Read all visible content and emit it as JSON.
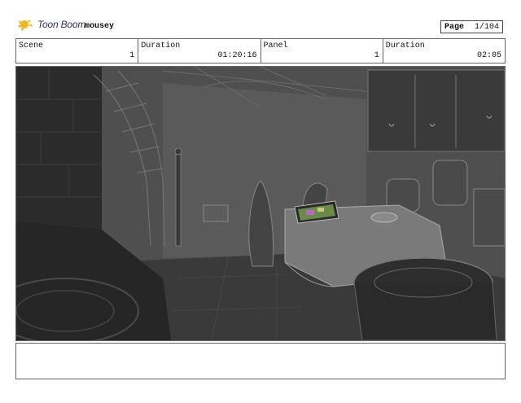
{
  "header": {
    "brand": "Toon Boom",
    "project": "mousey",
    "page_label": "Page",
    "page_value": "1/104"
  },
  "info": {
    "scene_label": "Scene",
    "scene_value": "1",
    "duration_label": "Duration",
    "duration_value": "01:20:16",
    "panel_label": "Panel",
    "panel_value": "1",
    "panel_duration_label": "Duration",
    "panel_duration_value": "02:05"
  },
  "notes": {
    "text": ""
  }
}
